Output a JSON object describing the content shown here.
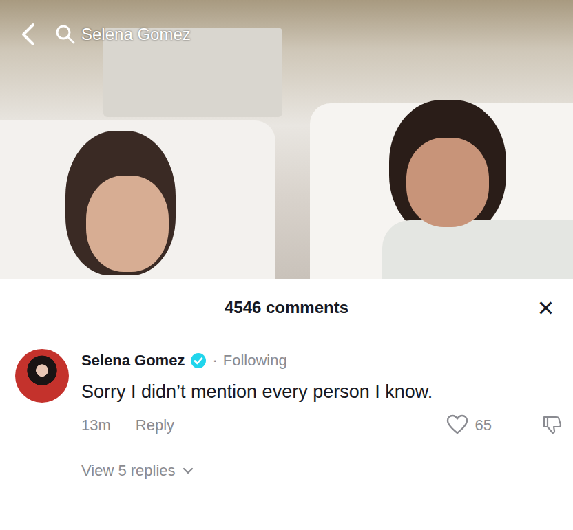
{
  "search_bar": {
    "query": "Selena Gomez"
  },
  "comments_sheet": {
    "count_label": "4546 comments",
    "close": "×"
  },
  "comment": {
    "author": "Selena Gomez",
    "verified": true,
    "separator": "·",
    "following": "Following",
    "text": "Sorry I didn’t mention every person I know.",
    "time": "13m",
    "reply": "Reply",
    "likes": "65",
    "liked": false,
    "view_replies": "View 5 replies"
  }
}
